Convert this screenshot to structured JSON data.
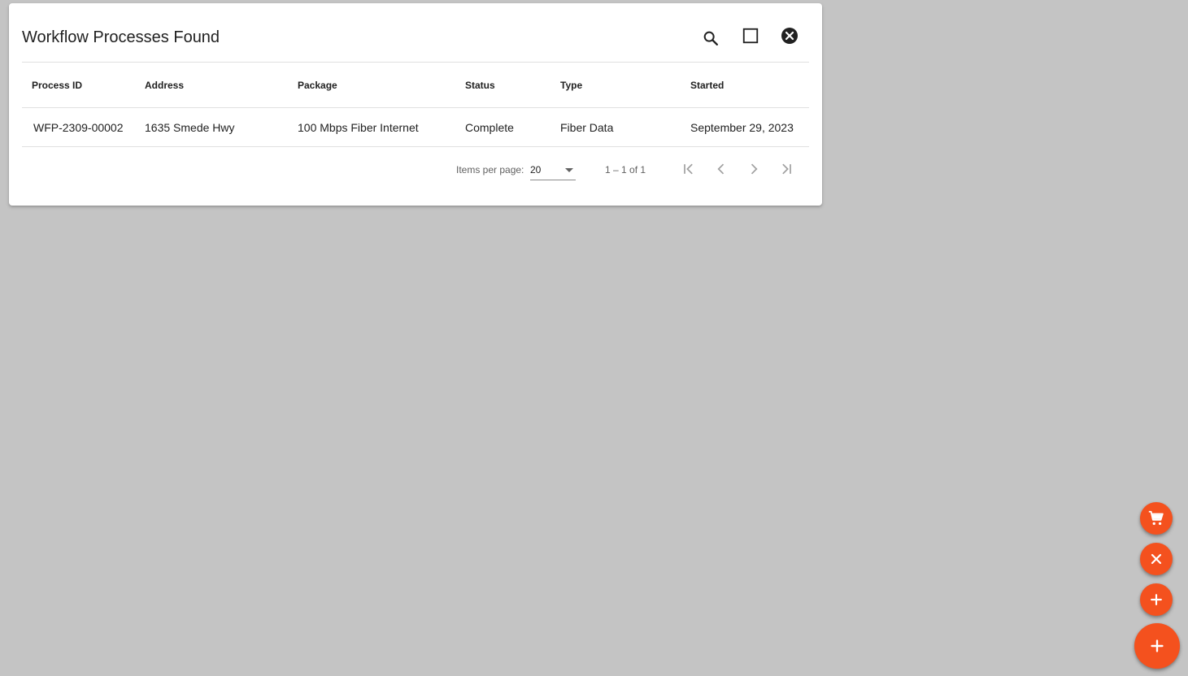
{
  "dialog": {
    "title": "Workflow Processes Found",
    "icons": [
      "search-icon",
      "maximize-icon",
      "close-circle-icon"
    ]
  },
  "table": {
    "columns": [
      "Process ID",
      "Address",
      "Package",
      "Status",
      "Type",
      "Started"
    ],
    "rows": [
      [
        "WFP-2309-00002",
        "1635 Smede Hwy",
        "100 Mbps Fiber Internet",
        "Complete",
        "Fiber Data",
        "September 29, 2023"
      ]
    ]
  },
  "paginator": {
    "items_per_page_label": "Items per page:",
    "items_per_page_value": "20",
    "range_label": "1 – 1 of 1",
    "icons": [
      "first-page-icon",
      "previous-page-icon",
      "next-page-icon",
      "last-page-icon"
    ]
  },
  "fabs": {
    "icons": [
      "cart-icon",
      "close-icon",
      "add-icon",
      "add-icon"
    ]
  },
  "colors": {
    "fab": "#f4511e",
    "background": "#c4c4c4",
    "dialog": "#ffffff"
  }
}
